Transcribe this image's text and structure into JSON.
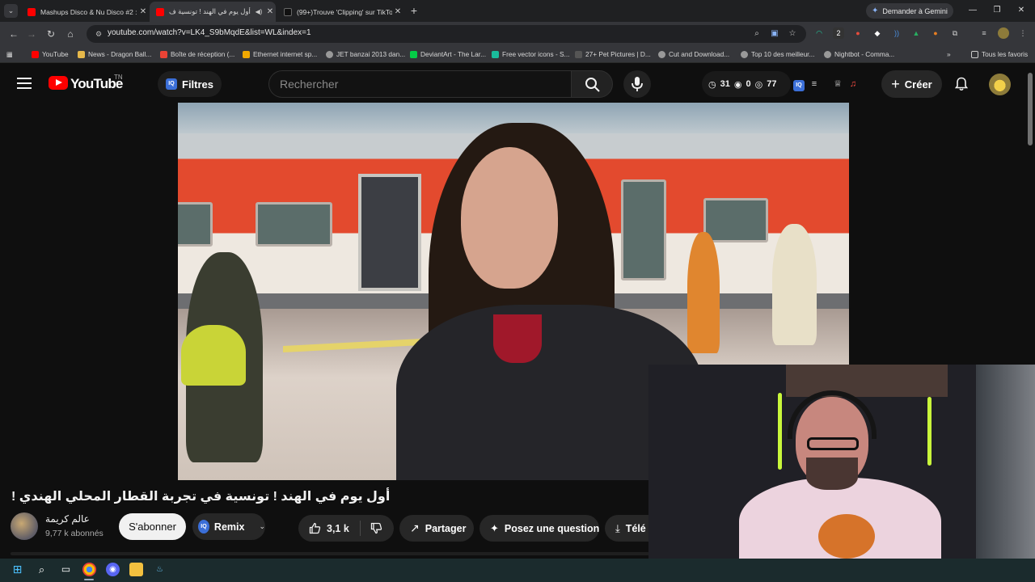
{
  "browser": {
    "tabs": [
      {
        "title": "Mashups Disco & Nu Disco #2 :",
        "favicon": "youtube-icon",
        "active": false
      },
      {
        "title": "أول يوم في الهند ! تونسية ف",
        "favicon": "youtube-icon",
        "active": true
      },
      {
        "title": "(99+)Trouve 'Clipping' sur TikTo",
        "favicon": "tiktok-icon",
        "active": false
      }
    ],
    "gemini_label": "Demander à Gemini",
    "url": "youtube.com/watch?v=LK4_S9bMqdE&list=WL&index=1",
    "ext_badge": "2",
    "bookmarks": [
      "YouTube",
      "News - Dragon Ball...",
      "Boîte de réception (...",
      "Ethernet internet sp...",
      "JET banzai 2013 dan...",
      "DeviantArt - The Lar...",
      "Free vector icons - S...",
      "27+ Pet Pictures | D...",
      "Cut and Download...",
      "Top 10 des meilleur...",
      "Nightbot - Comma..."
    ],
    "all_bookmarks": "Tous les favoris"
  },
  "youtube": {
    "logo_text": "YouTube",
    "country_code": "TN",
    "filters_label": "Filtres",
    "search_placeholder": "Rechercher",
    "stats": {
      "watched": "31",
      "views_a": "0",
      "views_b": "77"
    },
    "create_label": "Créer"
  },
  "video": {
    "title": "أول يوم في الهند ! تونسية في تجربة القطار المحلي الهندي !",
    "channel_name": "عالم كريمة",
    "subscribers": "9,77 k abonnés",
    "subscribe_label": "S'abonner",
    "remix_label": "Remix",
    "likes": "3,1 k",
    "share_label": "Partager",
    "ask_label": "Posez une question",
    "download_label": "Télé"
  },
  "colors": {
    "yt_red": "#ff0000",
    "bg": "#0f0f0f",
    "pill": "#272727",
    "accent_blue": "#3b6fd8"
  }
}
